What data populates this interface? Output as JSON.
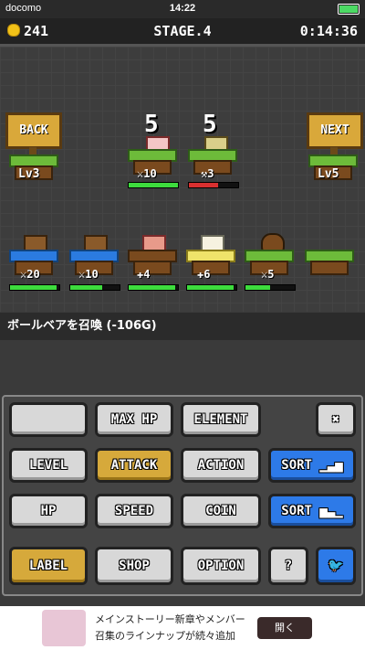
{
  "status_bar": {
    "carrier": "docomo",
    "time": "14:22"
  },
  "hud": {
    "coins": "241",
    "stage": "STAGE.4",
    "timer": "0:14:36"
  },
  "nav": {
    "back": "BACK",
    "next": "NEXT",
    "back_level": "Lv3",
    "next_level": "Lv5"
  },
  "top_units": [
    {
      "count": "5",
      "stat": "10",
      "hp": 1.0
    },
    {
      "count": "5",
      "stat": "3",
      "hp": 0.6
    }
  ],
  "bottom_units": [
    {
      "stat": "20",
      "hp": 0.95
    },
    {
      "stat": "10",
      "hp": 0.65
    },
    {
      "stat": "4",
      "hp": 0.95
    },
    {
      "stat": "6",
      "hp": 0.95
    },
    {
      "stat": "5",
      "hp": 0.5
    }
  ],
  "message": "ボールベアを召喚 (-106G)",
  "panel": {
    "max_hp": "MAX HP",
    "element": "ELEMENT",
    "level": "LEVEL",
    "attack": "ATTACK",
    "action": "ACTION",
    "sort_asc": "SORT",
    "hp": "HP",
    "speed": "SPEED",
    "coin": "COIN",
    "sort_desc": "SORT",
    "label": "LABEL",
    "shop": "SHOP",
    "option": "OPTION",
    "help": "?"
  },
  "ad": {
    "line1": "メインストーリー新章やメンバー",
    "line2": "召集のラインナップが続々追加",
    "open": "開く"
  }
}
